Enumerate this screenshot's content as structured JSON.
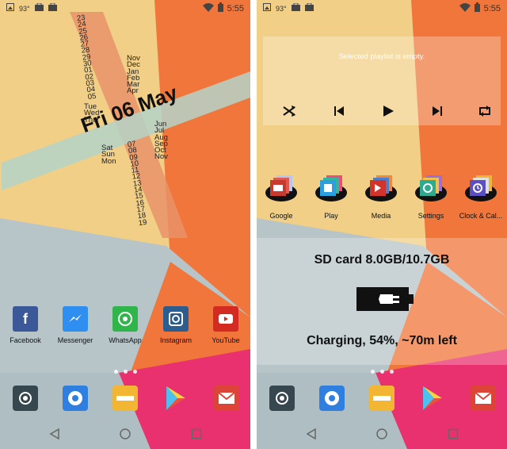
{
  "status_bar": {
    "temperature": "93°",
    "time": "5:55"
  },
  "left": {
    "clock": {
      "weekday": "Fri",
      "day": "06",
      "month": "May",
      "days_above": [
        "23",
        "24",
        "25",
        "26",
        "27",
        "28",
        "29",
        "30",
        "01",
        "02",
        "03",
        "04",
        "05"
      ],
      "days_below": [
        "07",
        "08",
        "09",
        "10",
        "11",
        "12",
        "13",
        "14",
        "15",
        "16",
        "17",
        "18",
        "19"
      ],
      "months_above": [
        "Nov",
        "Dec",
        "Jan",
        "Feb",
        "Mar",
        "Apr"
      ],
      "months_below": [
        "Jun",
        "Jul",
        "Aug",
        "Sep",
        "Oct",
        "Nov"
      ],
      "weekdays_above": [
        "Tue",
        "Wed",
        "Thu"
      ],
      "weekdays_below": [
        "Sat",
        "Sun",
        "Mon"
      ]
    },
    "apps": [
      {
        "label": "Facebook",
        "icon": "facebook-icon",
        "color": "#3b5998"
      },
      {
        "label": "Messenger",
        "icon": "messenger-icon",
        "color": "#2f8ff0"
      },
      {
        "label": "WhatsApp",
        "icon": "whatsapp-icon",
        "color": "#2fb54a"
      },
      {
        "label": "Instagram",
        "icon": "instagram-icon",
        "color": "#2c5d8f"
      },
      {
        "label": "YouTube",
        "icon": "youtube-icon",
        "color": "#d32a22"
      }
    ]
  },
  "right": {
    "player": {
      "message": "Selected playlist is empty."
    },
    "folders": [
      {
        "label": "Google",
        "icon": "google-folder-icon"
      },
      {
        "label": "Play",
        "icon": "play-folder-icon"
      },
      {
        "label": "Media",
        "icon": "media-folder-icon"
      },
      {
        "label": "Settings",
        "icon": "settings-folder-icon"
      },
      {
        "label": "Clock & Cal...",
        "icon": "clock-folder-icon"
      }
    ],
    "storage": {
      "text": "SD card 8.0GB/10.7GB"
    },
    "battery": {
      "text": "Charging, 54%, ~70m left",
      "percent": 54
    }
  },
  "dock": [
    {
      "icon": "camera-icon",
      "color": "#37474f"
    },
    {
      "icon": "chrome-icon",
      "color": "#2f7fe0"
    },
    {
      "icon": "tools-icon",
      "color": "#f2b632"
    },
    {
      "icon": "play-store-icon",
      "color": "#ffffff"
    },
    {
      "icon": "gmail-icon",
      "color": "#db4437"
    }
  ],
  "wallpaper": {
    "yellow": "#f1cf86",
    "orange": "#f0763b",
    "pink": "#e8316e",
    "gray": "#b5c4c8"
  }
}
